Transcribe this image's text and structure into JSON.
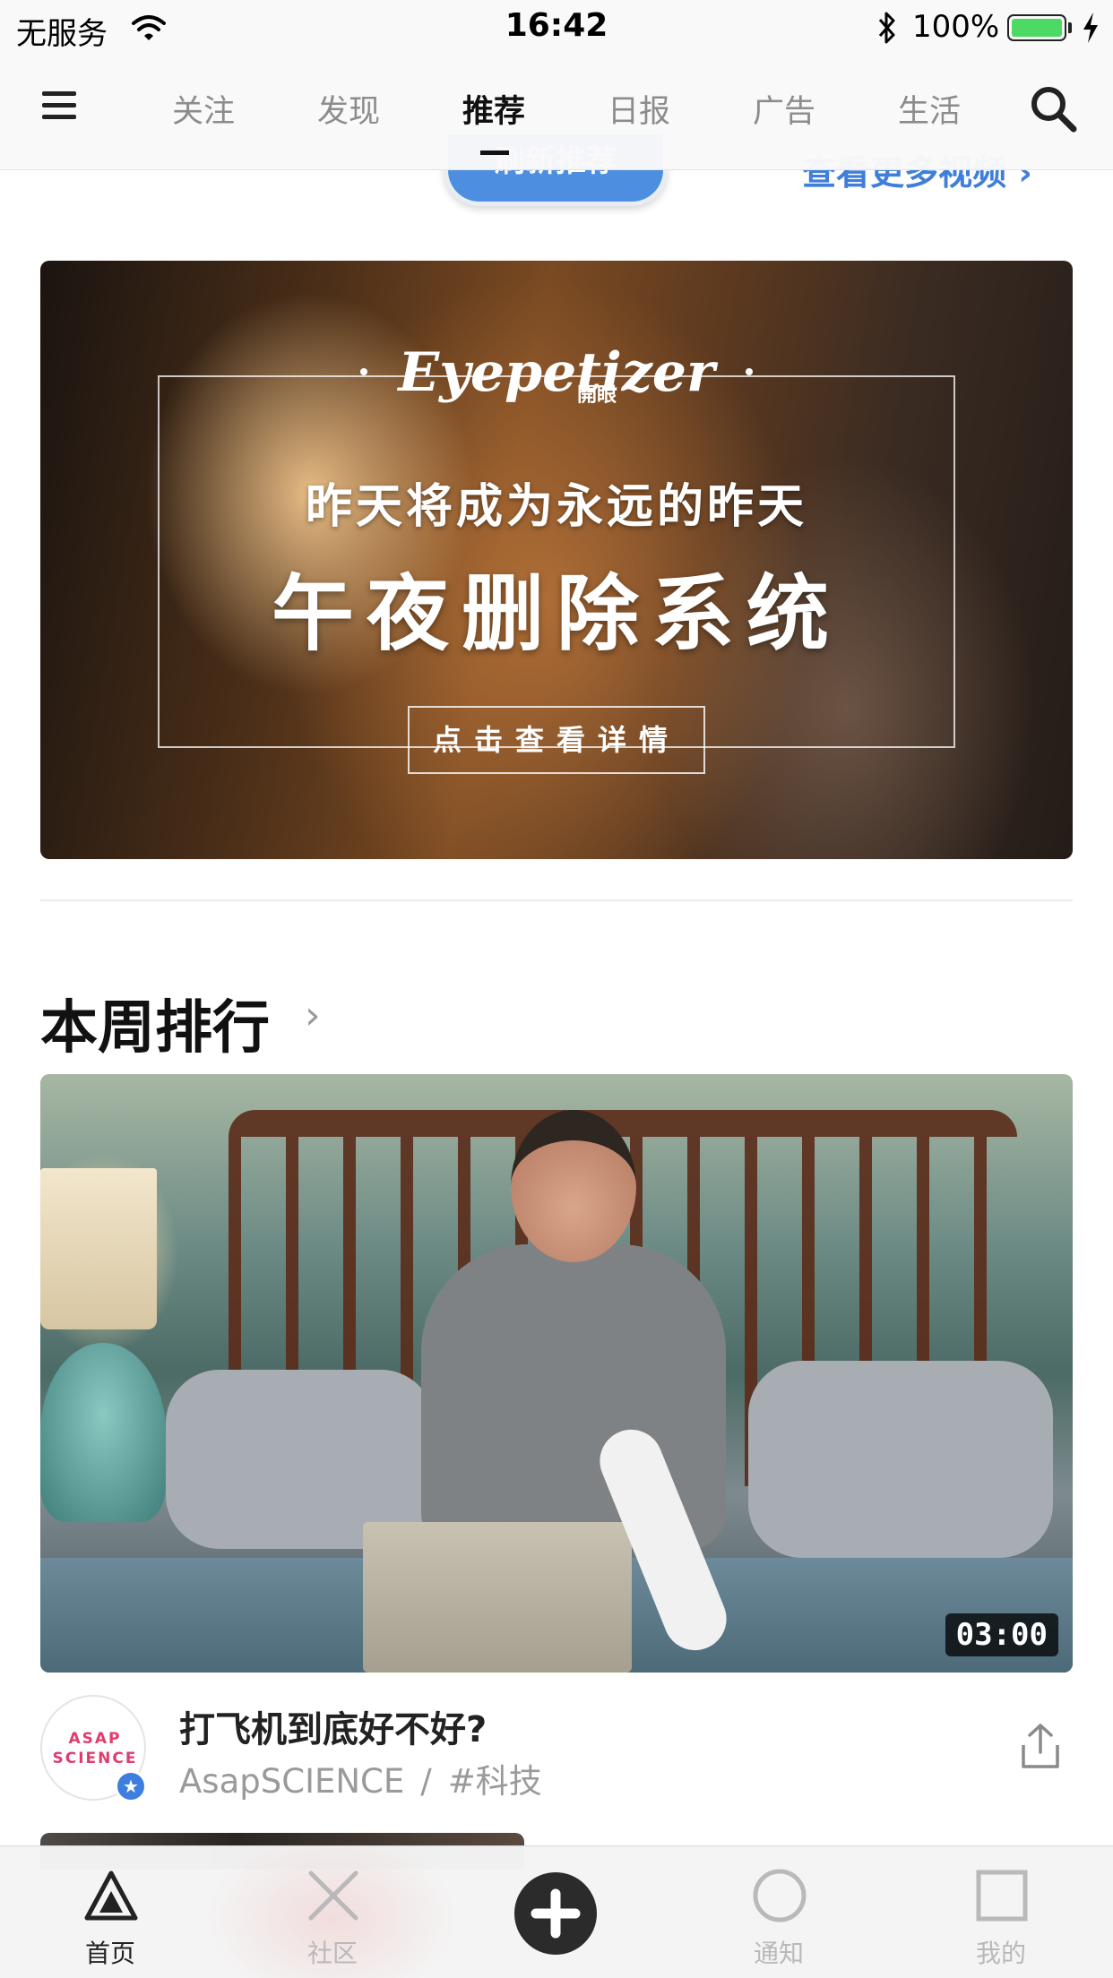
{
  "status_bar": {
    "carrier": "无服务",
    "time": "16:42",
    "battery_percent": "100%"
  },
  "nav": {
    "tabs": [
      {
        "label": "关注"
      },
      {
        "label": "发现"
      },
      {
        "label": "推荐"
      },
      {
        "label": "日报"
      },
      {
        "label": "广告"
      },
      {
        "label": "生活"
      }
    ],
    "active_tab": "推荐"
  },
  "refresh_button": {
    "label": "刷新推荐"
  },
  "more_videos_link": {
    "label": "查看更多视频 ›"
  },
  "banner": {
    "logo": "Eyepetizer",
    "logo_sub": "開眼",
    "line1": "昨天将成为永远的昨天",
    "line2": "午夜删除系统",
    "cta": "点击查看详情"
  },
  "weekly_ranking": {
    "title": "本周排行",
    "arrow": "›"
  },
  "video": {
    "duration": "03:00",
    "title": "打飞机到底好不好?",
    "author": "AsapSCIENCE",
    "separator": "/",
    "tag": "#科技",
    "avatar_text_line1": "ASAP",
    "avatar_text_line2": "SCIENCE"
  },
  "tabbar": {
    "items": [
      {
        "label": "首页",
        "icon": "triangle-home-icon"
      },
      {
        "label": "社区",
        "icon": "x-community-icon"
      },
      {
        "label": "",
        "icon": "plus-icon"
      },
      {
        "label": "通知",
        "icon": "circle-notification-icon"
      },
      {
        "label": "我的",
        "icon": "square-profile-icon"
      }
    ]
  },
  "colors": {
    "accent_blue": "#4d8ee0",
    "link_blue": "#3f7fd9",
    "battery_green": "#4cd964"
  }
}
